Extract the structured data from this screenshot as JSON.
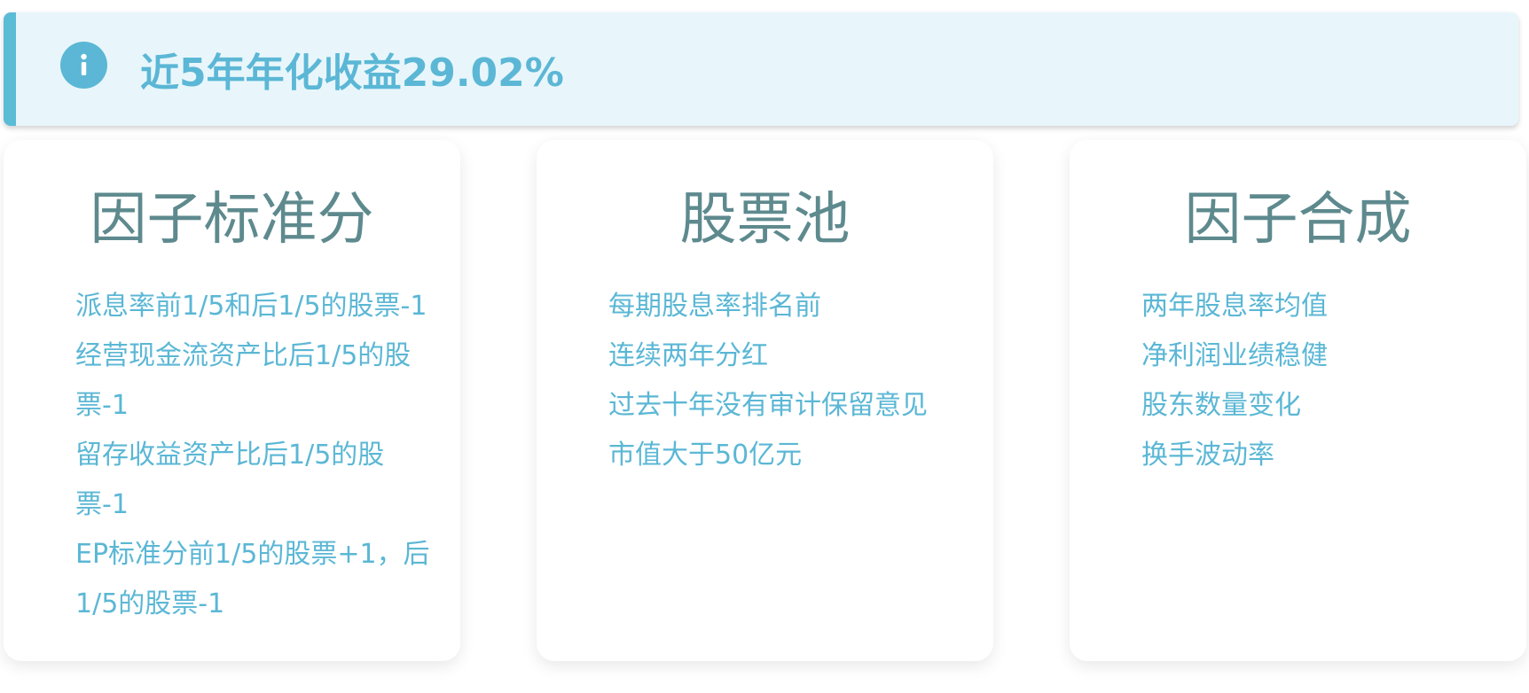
{
  "alert": {
    "icon": "info-icon",
    "text": "近5年年化收益29.02%",
    "accent_color": "#5bb7d5",
    "background_color": "#e8f6fb"
  },
  "cards": [
    {
      "title": "因子标准分",
      "items": [
        "派息率前1/5和后1/5的股票-1",
        "经营现金流资产比后1/5的股票-1",
        "留存收益资产比后1/5的股票-1",
        "EP标准分前1/5的股票+1，后1/5的股票-1"
      ]
    },
    {
      "title": "股票池",
      "items": [
        "每期股息率排名前",
        "连续两年分红",
        "过去十年没有审计保留意见",
        "市值大于50亿元"
      ]
    },
    {
      "title": "因子合成",
      "items": [
        "两年股息率均值",
        "净利润业绩稳健",
        "股东数量变化",
        "换手波动率"
      ]
    }
  ],
  "colors": {
    "title": "#5e8a8e",
    "item": "#5bb7d5"
  }
}
